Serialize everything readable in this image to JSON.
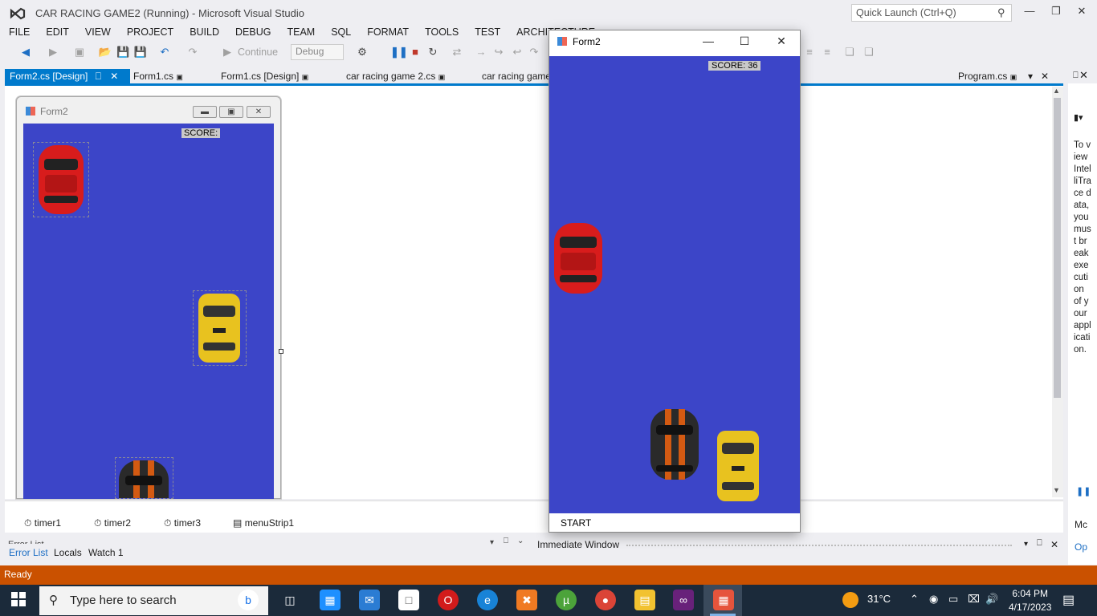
{
  "window": {
    "title": "CAR RACING GAME2 (Running) - Microsoft Visual Studio",
    "quick_launch_placeholder": "Quick Launch (Ctrl+Q)"
  },
  "menu": [
    "FILE",
    "EDIT",
    "VIEW",
    "PROJECT",
    "BUILD",
    "DEBUG",
    "TEAM",
    "SQL",
    "FORMAT",
    "TOOLS",
    "TEST",
    "ARCHITECTURE"
  ],
  "toolbar": {
    "continue_label": "Continue",
    "config_value": "Debug"
  },
  "tabs": [
    "Form2.cs [Design]",
    "Form1.cs",
    "Form1.cs [Design]",
    "car racing game 2.cs",
    "car racing game"
  ],
  "tab_right": "Program.cs",
  "designer_form": {
    "title": "Form2",
    "score_label": "SCORE:"
  },
  "component_tray": [
    "timer1",
    "timer2",
    "timer3",
    "menuStrip1"
  ],
  "bottom_tabs": [
    "Error List",
    "Locals",
    "Watch 1"
  ],
  "bottom_hidden_tab": "Error List",
  "immediate_title": "Immediate Window",
  "side_panel_text": "To view IntelliTrace data, you must break execution of your application.",
  "side_panel_bottom": [
    "Mc",
    "Op"
  ],
  "status_text": "Ready",
  "taskbar": {
    "search_placeholder": "Type here to search",
    "weather": "31°C",
    "time": "6:04 PM",
    "date": "4/17/2023"
  },
  "running_form": {
    "title": "Form2",
    "score_text": "SCORE: 36",
    "menu_item": "START"
  },
  "colors": {
    "game_bg": "#3c45c8",
    "accent": "#007acc",
    "status": "#ca5100"
  }
}
